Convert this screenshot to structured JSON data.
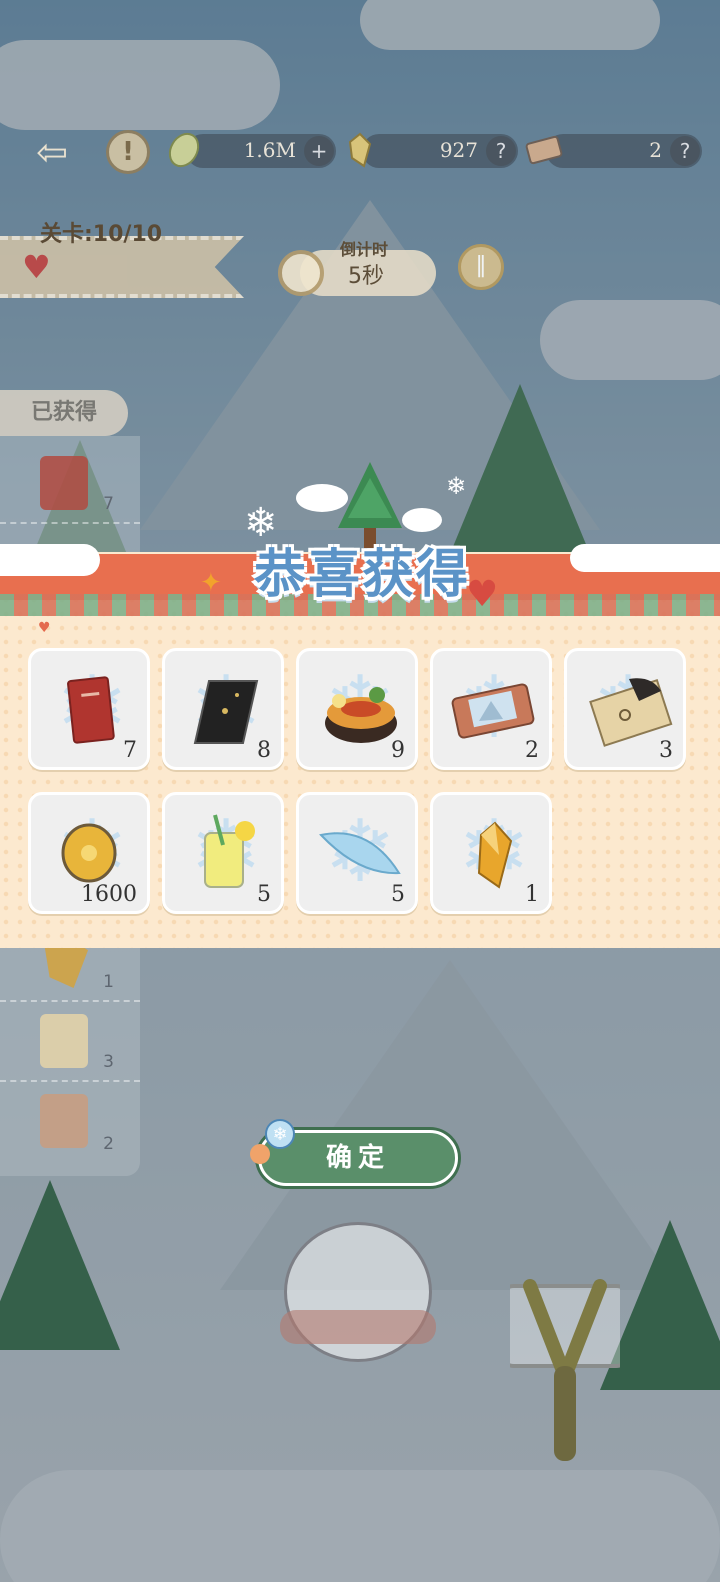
{
  "hud": {
    "resources": [
      {
        "icon": "leaf-coin-icon",
        "value": "1.6M",
        "action": "+"
      },
      {
        "icon": "crystal-icon",
        "value": "927",
        "action": "?"
      },
      {
        "icon": "ticket-icon",
        "value": "2",
        "action": "?"
      }
    ]
  },
  "level": {
    "label": "关卡:10/10"
  },
  "timer": {
    "title": "倒计时",
    "value": "5秒"
  },
  "collected": {
    "title": "已获得",
    "items": [
      {
        "icon": "red-book-icon",
        "count": "7"
      },
      {
        "icon": "crystal-icon",
        "count": "1"
      },
      {
        "icon": "note-card-icon",
        "count": "3"
      },
      {
        "icon": "ticket-icon",
        "count": "2"
      }
    ]
  },
  "modal": {
    "title": "恭喜获得",
    "rewards": [
      {
        "icon": "red-book-icon",
        "count": "7"
      },
      {
        "icon": "black-card-icon",
        "count": "8"
      },
      {
        "icon": "food-bowl-icon",
        "count": "9"
      },
      {
        "icon": "ticket-icon",
        "count": "2"
      },
      {
        "icon": "note-card-icon",
        "count": "3"
      },
      {
        "icon": "gold-coin-icon",
        "count": "1600"
      },
      {
        "icon": "lemonade-icon",
        "count": "5"
      },
      {
        "icon": "feather-icon",
        "count": "5"
      },
      {
        "icon": "crystal-icon",
        "count": "1"
      }
    ],
    "confirm_label": "确定"
  },
  "colors": {
    "modal_bg": "#fce9cf",
    "title_blue": "#5b93c7",
    "confirm_green": "#5a8f6a",
    "band_red": "#e86f4f"
  }
}
